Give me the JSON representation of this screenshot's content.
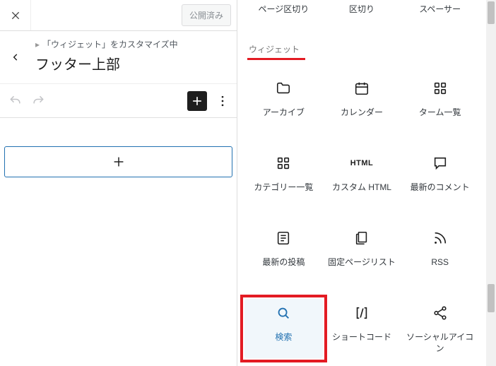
{
  "header": {
    "publish_label": "公開済み"
  },
  "breadcrumb": {
    "trail": "「ウィジェット」をカスタマイズ中",
    "title": "フッター上部"
  },
  "inserter": {
    "top_row": [
      "ページ区切り",
      "区切り",
      "スペーサー"
    ],
    "section_title": "ウィジェット",
    "blocks": [
      {
        "id": "archives",
        "label": "アーカイブ",
        "icon": "folder"
      },
      {
        "id": "calendar",
        "label": "カレンダー",
        "icon": "calendar"
      },
      {
        "id": "tag-cloud",
        "label": "ターム一覧",
        "icon": "grid4"
      },
      {
        "id": "categories",
        "label": "カテゴリー一覧",
        "icon": "grid4"
      },
      {
        "id": "custom-html",
        "label": "カスタム HTML",
        "icon": "html"
      },
      {
        "id": "latest-comments",
        "label": "最新のコメント",
        "icon": "comment"
      },
      {
        "id": "latest-posts",
        "label": "最新の投稿",
        "icon": "postlist"
      },
      {
        "id": "page-list",
        "label": "固定ページリスト",
        "icon": "pages"
      },
      {
        "id": "rss",
        "label": "RSS",
        "icon": "rss"
      },
      {
        "id": "search",
        "label": "検索",
        "icon": "search",
        "selected": true,
        "highlighted": true
      },
      {
        "id": "shortcode",
        "label": "ショートコード",
        "icon": "shortcode"
      },
      {
        "id": "social-icons",
        "label": "ソーシャルアイコン",
        "icon": "share"
      }
    ]
  }
}
